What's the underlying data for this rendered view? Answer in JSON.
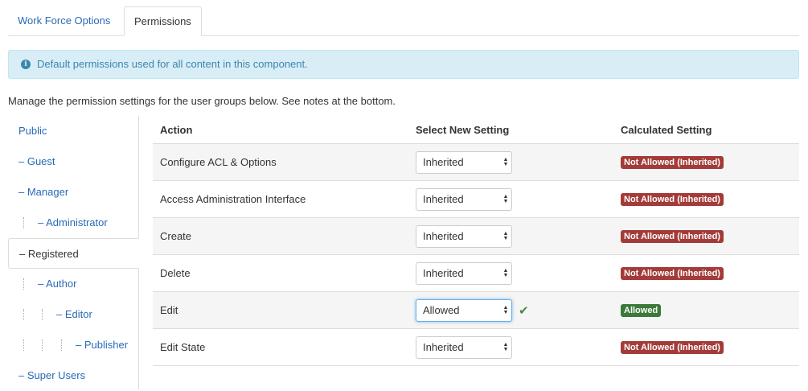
{
  "tabs": [
    {
      "label": "Work Force Options",
      "active": false
    },
    {
      "label": "Permissions",
      "active": true
    }
  ],
  "alert": {
    "text": "Default permissions used for all content in this component.",
    "icon": "info-icon"
  },
  "intro": "Manage the permission settings for the user groups below. See notes at the bottom.",
  "groups": [
    {
      "label": "Public"
    },
    {
      "label": "– Guest"
    },
    {
      "label": "– Manager"
    },
    {
      "label": "– Administrator"
    },
    {
      "label": "– Registered",
      "active": true
    },
    {
      "label": "– Author"
    },
    {
      "label": "– Editor"
    },
    {
      "label": "– Publisher"
    },
    {
      "label": "– Super Users"
    }
  ],
  "table": {
    "headers": {
      "action": "Action",
      "select": "Select New Setting",
      "calculated": "Calculated Setting"
    },
    "rows": [
      {
        "action": "Configure ACL & Options",
        "setting": "Inherited",
        "calculated": "Not Allowed (Inherited)"
      },
      {
        "action": "Access Administration Interface",
        "setting": "Inherited",
        "calculated": "Not Allowed (Inherited)"
      },
      {
        "action": "Create",
        "setting": "Inherited",
        "calculated": "Not Allowed (Inherited)"
      },
      {
        "action": "Delete",
        "setting": "Inherited",
        "calculated": "Not Allowed (Inherited)"
      },
      {
        "action": "Edit",
        "setting": "Allowed",
        "calculated": "Allowed",
        "saved": true
      },
      {
        "action": "Edit State",
        "setting": "Inherited",
        "calculated": "Not Allowed (Inherited)"
      }
    ]
  },
  "colors": {
    "link": "#2a69b8",
    "not_allowed": "#a33b39",
    "allowed": "#3b7a39",
    "alert_bg": "#d9edf7"
  }
}
